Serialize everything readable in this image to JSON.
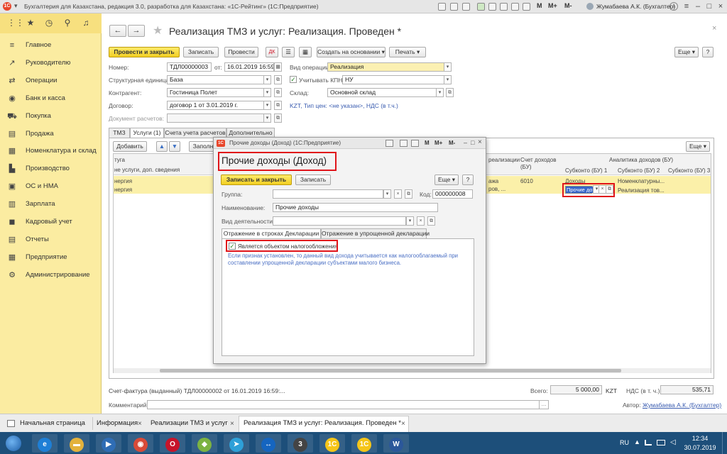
{
  "window": {
    "title": "Бухгалтерия для Казахстана, редакция 3.0, разработка для Казахстана: «1С-Рейтинг» (1С:Предприятие)",
    "user": "Жумабаева А.К. (Бухгалтер)",
    "m_labels": [
      "M",
      "M+",
      "M-"
    ]
  },
  "sidebar": {
    "items": [
      {
        "label": "Главное",
        "icon": "menu-icon"
      },
      {
        "label": "Руководителю",
        "icon": "trend-icon"
      },
      {
        "label": "Операции",
        "icon": "operations-icon"
      },
      {
        "label": "Банк и касса",
        "icon": "bank-icon"
      },
      {
        "label": "Покупка",
        "icon": "cart-icon"
      },
      {
        "label": "Продажа",
        "icon": "sale-icon"
      },
      {
        "label": "Номенклатура и склад",
        "icon": "warehouse-icon"
      },
      {
        "label": "Производство",
        "icon": "factory-icon"
      },
      {
        "label": "ОС и НМА",
        "icon": "assets-icon"
      },
      {
        "label": "Зарплата",
        "icon": "salary-icon"
      },
      {
        "label": "Кадровый учет",
        "icon": "staff-icon"
      },
      {
        "label": "Отчеты",
        "icon": "reports-icon"
      },
      {
        "label": "Предприятие",
        "icon": "company-icon"
      },
      {
        "label": "Администрирование",
        "icon": "gear-icon"
      }
    ]
  },
  "doc": {
    "title": "Реализация ТМЗ и услуг: Реализация. Проведен *",
    "toolbar": {
      "post_close": "Провести и закрыть",
      "save": "Записать",
      "post": "Провести",
      "create_based": "Создать на основании",
      "print": "Печать",
      "more": "Еще"
    },
    "fields": {
      "number_label": "Номер:",
      "number": "ТДЛ00000003",
      "date_label": "от:",
      "date": "16.01.2019 16:59:5",
      "op_type_label": "Вид операции:",
      "op_type": "Реализация",
      "unit_label": "Структурная единица:",
      "unit": "База",
      "kpn_label": "Учитывать КПН",
      "kpn": "НУ",
      "contractor_label": "Контрагент:",
      "contractor": "Гостиница Полет",
      "warehouse_label": "Склад:",
      "warehouse": "Основной склад",
      "contract_label": "Договор:",
      "contract": "договор 1 от 3.01.2019 г.",
      "price_link": "KZT, Тип цен: <не указан>, НДС (в т.ч.)",
      "settlement_label": "Документ расчетов:"
    },
    "tabs": [
      "ТМЗ",
      "Услуги (1)",
      "Счета учета расчетов",
      "Дополнительно"
    ],
    "table_toolbar": {
      "add": "Добавить",
      "fill": "Заполн",
      "more": "Еще"
    },
    "table": {
      "left_header_1": "туга",
      "left_header_2": "не услуги, доп. сведения",
      "left_rows": [
        "нергия",
        "нергия"
      ],
      "col_realization": "реализации",
      "col_income_account": "Счет доходов (БУ)",
      "col_analytics": "Аналитика доходов (БУ)",
      "col_sub1": "Субконто (БУ) 1",
      "col_sub2": "Субконто (БУ) 2",
      "col_sub3": "Субконто (БУ) 3",
      "row1": {
        "realization": "ажа",
        "account": "6010",
        "sub1": "Доходы",
        "sub2": "Номенклатурны..."
      },
      "row2": {
        "realization": "ров, ...",
        "sub1": "Прочие до",
        "sub2": "Реализация тов..."
      }
    },
    "footer": {
      "invoice": "Счет-фактура (выданный) ТДЛ00000002 от 16.01.2019 16:59:...",
      "total_label": "Всего:",
      "total": "5 000,00",
      "currency": "KZT",
      "vat_label": "НДС (в т. ч.):",
      "vat": "535,71",
      "comment_label": "Комментарий:",
      "author_label": "Автор:",
      "author": "Жумабаева А.К. (Бухгалтер)"
    }
  },
  "modal": {
    "window_title": "Прочие доходы (Доход)  (1С:Предприятие)",
    "title": "Прочие доходы (Доход)",
    "save_close": "Записать и закрыть",
    "save": "Записать",
    "more": "Еще",
    "help": "?",
    "group_label": "Группа:",
    "code_label": "Код:",
    "code": "000000008",
    "name_label": "Наименование:",
    "name": "Прочие доходы",
    "activity_label": "Вид деятельности:",
    "tabs": [
      "Отражение в строках Декларации",
      "Отражение в упрощенной декларации"
    ],
    "taxable_label": "Является объектом налогообложения",
    "taxable_note": "Если признак установлен, то данный вид дохода учитывается как налогооблагаемый при составлении упрощенной декларации субъектами малого бизнеса."
  },
  "window_tabs": [
    "Начальная страница",
    "Информация",
    "Реализации ТМЗ и услуг",
    "Реализация ТМЗ и услуг: Реализация. Проведен *"
  ],
  "taskbar": {
    "lang": "RU",
    "time": "12:34",
    "date": "30.07.2019",
    "apps": [
      "ie-icon",
      "folder-icon",
      "media-icon",
      "chrome-icon",
      "opera-icon",
      "android-icon",
      "telegram-icon",
      "teamviewer-icon",
      "3cx-icon",
      "1c-icon",
      "1c-icon",
      "word-icon"
    ]
  },
  "colors": {
    "accent": "#f2cf22",
    "sidebar": "#fbeca1",
    "highlight": "#e0141a",
    "taskbar": "#1d4f7a"
  }
}
